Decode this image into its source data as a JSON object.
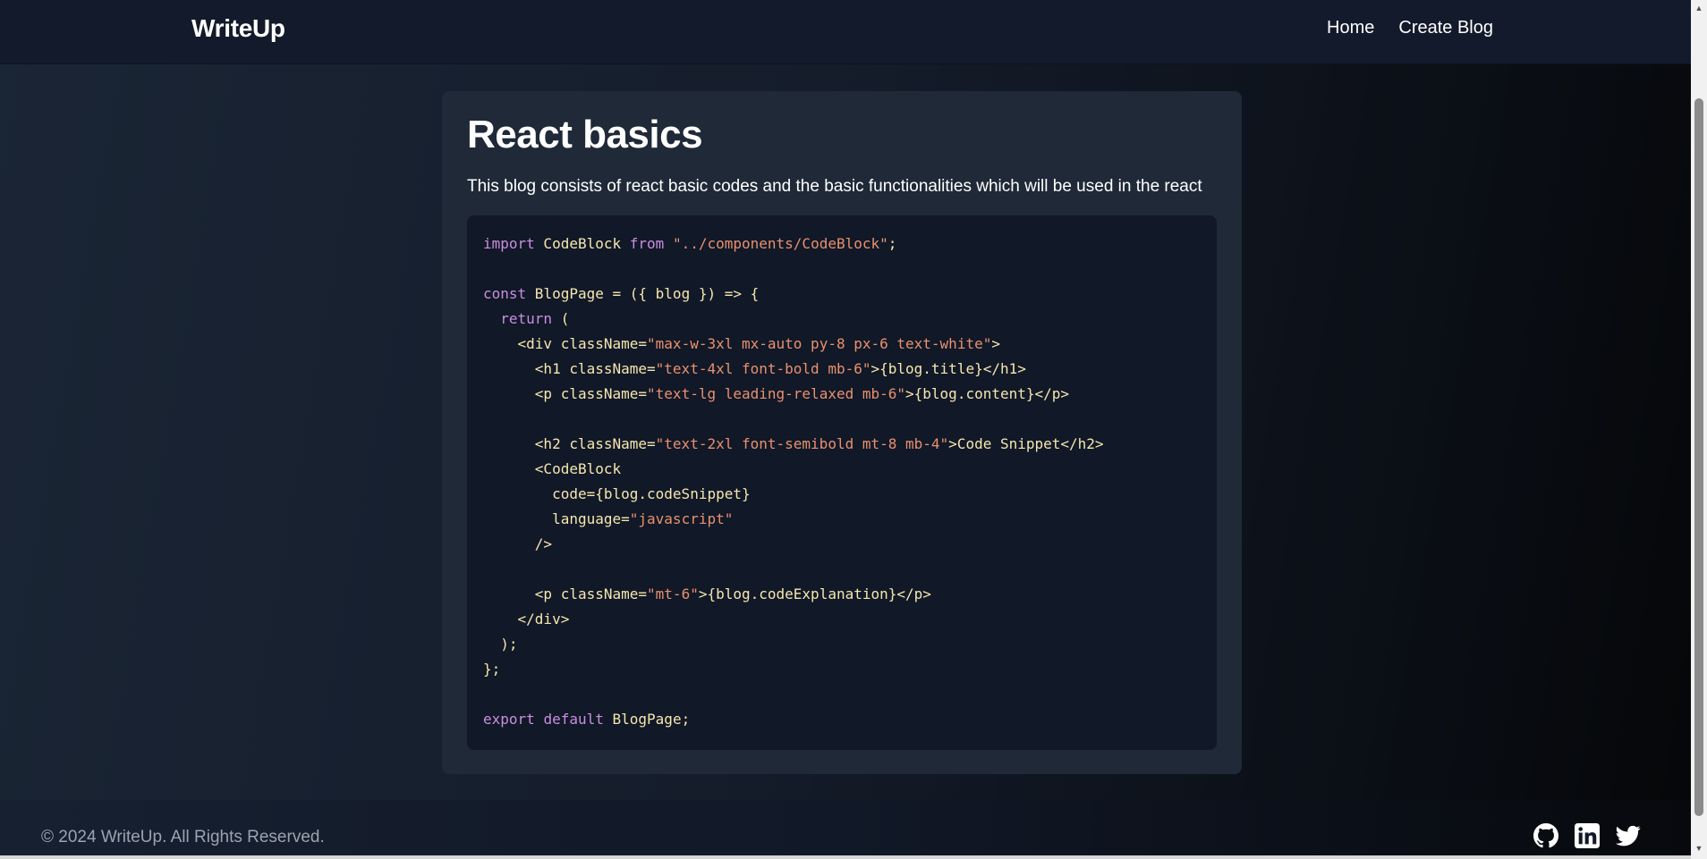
{
  "navbar": {
    "brand": "WriteUp",
    "links": [
      "Home",
      "Create Blog"
    ]
  },
  "blog": {
    "title": "React basics",
    "description": "This blog consists of react basic codes and the basic functionalities which will be used in the react",
    "code_lines": [
      [
        [
          "kw",
          "import"
        ],
        [
          "",
          " CodeBlock "
        ],
        [
          "kw",
          "from"
        ],
        [
          "",
          " "
        ],
        [
          "str",
          "\"../components/CodeBlock\""
        ],
        [
          "",
          ";"
        ]
      ],
      [],
      [
        [
          "kw",
          "const"
        ],
        [
          "",
          " BlogPage = ({ blog }) => {"
        ]
      ],
      [
        [
          "",
          "  "
        ],
        [
          "kw",
          "return"
        ],
        [
          "",
          " ("
        ]
      ],
      [
        [
          "",
          "    <div className="
        ],
        [
          "str",
          "\"max-w-3xl mx-auto py-8 px-6 text-white\""
        ],
        [
          "",
          ">"
        ]
      ],
      [
        [
          "",
          "      <h1 className="
        ],
        [
          "str",
          "\"text-4xl font-bold mb-6\""
        ],
        [
          "",
          ">{blog.title}</h1>"
        ]
      ],
      [
        [
          "",
          "      <p className="
        ],
        [
          "str",
          "\"text-lg leading-relaxed mb-6\""
        ],
        [
          "",
          ">{blog.content}</p>"
        ]
      ],
      [],
      [
        [
          "",
          "      <h2 className="
        ],
        [
          "str",
          "\"text-2xl font-semibold mt-8 mb-4\""
        ],
        [
          "",
          ">Code Snippet</h2>"
        ]
      ],
      [
        [
          "",
          "      <CodeBlock"
        ]
      ],
      [
        [
          "",
          "        code={blog.codeSnippet}"
        ]
      ],
      [
        [
          "",
          "        language="
        ],
        [
          "str",
          "\"javascript\""
        ]
      ],
      [
        [
          "",
          "      />"
        ]
      ],
      [],
      [
        [
          "",
          "      <p className="
        ],
        [
          "str",
          "\"mt-6\""
        ],
        [
          "",
          ">{blog.codeExplanation}</p>"
        ]
      ],
      [
        [
          "",
          "    </div>"
        ]
      ],
      [
        [
          "",
          "  );"
        ]
      ],
      [
        [
          "",
          "};"
        ]
      ],
      [],
      [
        [
          "kw",
          "export"
        ],
        [
          "",
          " "
        ],
        [
          "kw",
          "default"
        ],
        [
          "",
          " BlogPage;"
        ]
      ]
    ]
  },
  "footer": {
    "copyright": "© 2024 WriteUp. All Rights Reserved.",
    "socials": [
      "github-icon",
      "linkedin-icon",
      "twitter-icon"
    ]
  },
  "colors": {
    "code_keyword": "#c98fe0",
    "code_string": "#e8916f",
    "code_text": "#f6e7b0",
    "card_bg": "#1f2937",
    "code_bg": "#111827"
  }
}
